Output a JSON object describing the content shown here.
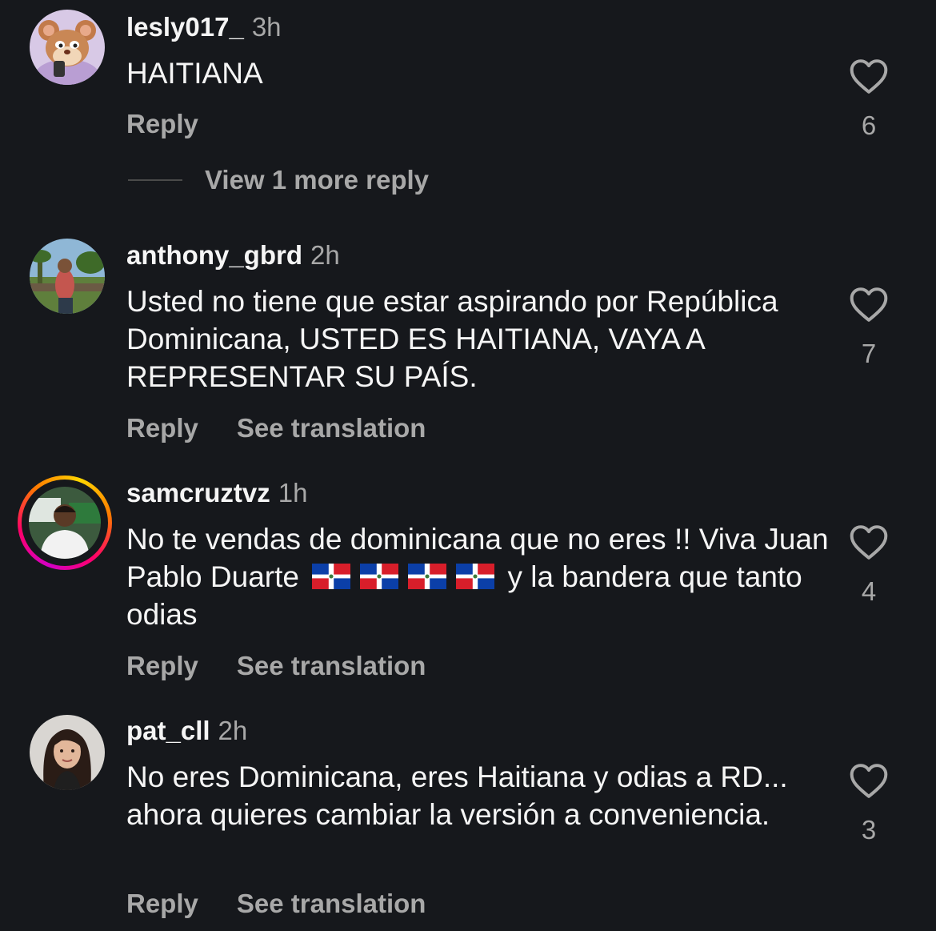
{
  "comments": [
    {
      "username": "lesly017_",
      "time": "3h",
      "text": "HAITIANA",
      "reply_label": "Reply",
      "likes": "6",
      "view_more": "View 1 more reply"
    },
    {
      "username": "anthony_gbrd",
      "time": "2h",
      "text": "Usted no tiene que estar aspirando por República Dominicana, USTED ES HAITIANA, VAYA A REPRESENTAR SU PAÍS.",
      "reply_label": "Reply",
      "translate_label": "See translation",
      "likes": "7"
    },
    {
      "username": "samcruztvz",
      "time": "1h",
      "text_part1": "No te vendas de dominicana que no eres !! Viva Juan Pablo Duarte",
      "text_part2": "y la bandera que tanto odias",
      "flags": [
        "dominican-republic-flag",
        "dominican-republic-flag",
        "dominican-republic-flag",
        "dominican-republic-flag"
      ],
      "reply_label": "Reply",
      "translate_label": "See translation",
      "likes": "4"
    },
    {
      "username": "pat_cll",
      "time": "2h",
      "text": "No eres Dominicana, eres Haitiana y odias a RD... ahora quieres cambiar la versión a conveniencia.",
      "reply_label": "Reply",
      "translate_label": "See translation",
      "likes": "3"
    }
  ],
  "icons": {
    "like": "heart-outline-icon"
  },
  "colors": {
    "background": "#16181c",
    "text": "#f5f5f5",
    "muted": "#a8a8a8"
  }
}
